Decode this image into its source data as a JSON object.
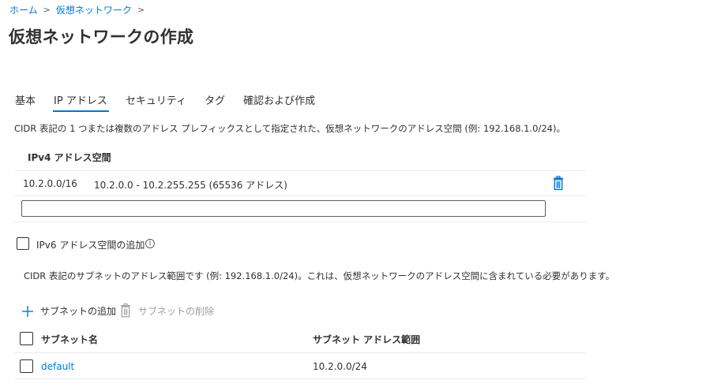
{
  "breadcrumb": {
    "items": [
      "ホーム",
      "仮想ネットワーク"
    ],
    "separator": ">"
  },
  "page": {
    "title": "仮想ネットワークの作成"
  },
  "tabs": [
    {
      "label": "基本",
      "active": false
    },
    {
      "label": "IP アドレス",
      "active": true
    },
    {
      "label": "セキュリティ",
      "active": false
    },
    {
      "label": "タグ",
      "active": false
    },
    {
      "label": "確認および作成",
      "active": false
    }
  ],
  "ip_section": {
    "description": "CIDR 表記の 1 つまたは複数のアドレス プレフィックスとして指定された、仮想ネットワークのアドレス空間 (例: 192.168.1.0/24)。",
    "ipv4_header": "IPv4 アドレス空間",
    "address_rows": [
      {
        "prefix": "10.2.0.0/16",
        "range": "10.2.0.0 - 10.2.255.255 (65536 アドレス)"
      }
    ],
    "new_address_value": "",
    "ipv6_label": "IPv6 アドレス空間の追加",
    "ipv6_checked": false,
    "info_glyph": "i"
  },
  "subnet_section": {
    "description": "CIDR 表記のサブネットのアドレス範囲です (例: 192.168.1.0/24)。これは、仮想ネットワークのアドレス空間に含まれている必要があります。",
    "add_label": "サブネットの追加",
    "delete_label": "サブネットの削除",
    "columns": {
      "name": "サブネット名",
      "range": "サブネット アドレス範囲"
    },
    "rows": [
      {
        "name": "default",
        "range": "10.2.0.0/24"
      }
    ]
  },
  "icons": {
    "trash": "trash-icon",
    "plus": "plus-icon",
    "info": "info-icon"
  },
  "colors": {
    "accent": "#0078d4",
    "text": "#323130",
    "disabled": "#a19f9d",
    "divider": "#edebe9"
  }
}
